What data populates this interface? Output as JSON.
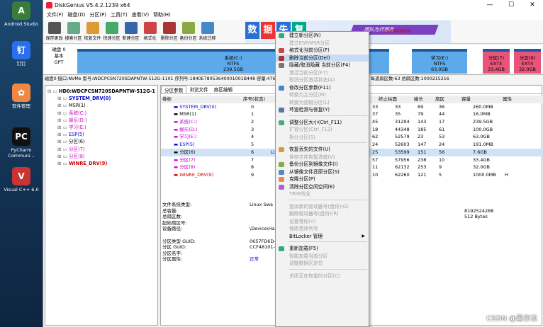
{
  "desktop": [
    {
      "label": "Android Studio",
      "glyph": "A",
      "color": "#3a7d3a"
    },
    {
      "label": "钉钉",
      "glyph": "钉",
      "color": "#2a6ff0"
    },
    {
      "label": "软件管理",
      "glyph": "✿",
      "color": "#e84"
    },
    {
      "label": "PyCharm Communi...",
      "glyph": "PC",
      "color": "#111"
    },
    {
      "label": "Visual C++ 6.0",
      "glyph": "V",
      "color": "#c33"
    }
  ],
  "window": {
    "title": "DiskGenius V5.4.2.1239 x64",
    "controls": [
      "—",
      "☐",
      "✕"
    ]
  },
  "menu": [
    "文件(F)",
    "磁盘(D)",
    "分区(P)",
    "工具(T)",
    "查看(V)",
    "帮助(H)"
  ],
  "toolbar": [
    {
      "label": "保存更改",
      "color": "#555"
    },
    {
      "label": "搜索分区",
      "color": "#6a8"
    },
    {
      "label": "恢复文件",
      "color": "#d93"
    },
    {
      "label": "快速分区",
      "color": "#4a6"
    },
    {
      "label": "新建分区",
      "color": "#36a"
    },
    {
      "label": "格式化",
      "color": "#c44"
    },
    {
      "label": "删除分区",
      "color": "#a33"
    },
    {
      "label": "备份分区",
      "color": "#8a4"
    },
    {
      "label": "系统迁移",
      "color": "#48c"
    }
  ],
  "banner": {
    "tiles": [
      "数",
      "据",
      "失",
      "复"
    ],
    "tile_colors": [
      "#2a6fd6",
      "#e33",
      "#2a6fd6",
      "#0a8"
    ],
    "slogan": "团队为您服务",
    "phone": "400-008-9958",
    "qq": "QQ"
  },
  "disk": {
    "label1": "磁盘 0",
    "label2": "基本",
    "label3": "GPT",
    "parts": [
      {
        "name": "系统(C:)",
        "fs": "NTFS",
        "size": "239.5GB",
        "color": "#5da9e9"
      },
      {
        "name": "学习(E:)",
        "fs": "NTFS",
        "size": "63.0GB",
        "color": "#5da9e9"
      },
      {
        "name": "分区(7)",
        "fs": "EXT4",
        "size": "33.4GB",
        "color": "#e8547a"
      },
      {
        "name": "分区(8)",
        "fs": "EXT4",
        "size": "32.0GB",
        "color": "#e8547a"
      }
    ]
  },
  "infoline": "磁盘0 接口:NVMe  型号:WDCPCSN720SDAPNTW-512G-1101  序列号:1840E78053640001001B448  容量:476.9GB(488386MB)  柱面数:62260  磁头数:255  每道扇区数:63  总扇区数:1000215216",
  "tree": [
    {
      "t": "HD0:WDCPCSN720SDAPNTW-512G-1",
      "c": "#000",
      "bold": true,
      "ind": 0
    },
    {
      "t": "SYSTEM_DRV(0)",
      "c": "#00c",
      "bold": true,
      "ind": 1
    },
    {
      "t": "MSR(1)",
      "c": "#000",
      "ind": 1
    },
    {
      "t": "系统(C:)",
      "c": "#c0c",
      "ind": 1
    },
    {
      "t": "娱乐(D:)",
      "c": "#c0c",
      "ind": 1
    },
    {
      "t": "学习(E:)",
      "c": "#c0c",
      "ind": 1
    },
    {
      "t": "ESP(5)",
      "c": "#00c",
      "ind": 1
    },
    {
      "t": "分区(6)",
      "c": "#000",
      "ind": 1
    },
    {
      "t": "分区(7)",
      "c": "#c0c",
      "ind": 1
    },
    {
      "t": "分区(8)",
      "c": "#c0c",
      "ind": 1
    },
    {
      "t": "WINRE_DRV(9)",
      "c": "#c00",
      "bold": true,
      "ind": 1
    }
  ],
  "tabs": [
    "分区参数",
    "浏览文件",
    "扇区编辑"
  ],
  "table": {
    "headers": [
      "卷标",
      "序号(状态)",
      "终止柱面",
      "磁头",
      "扇区",
      "容量",
      "属性"
    ],
    "rows": [
      {
        "v": "SYSTEM_DRV(0)",
        "c": "#00c",
        "n": "0",
        "a": "33",
        "b": "33",
        "h": "69",
        "s": "36",
        "cap": "260.0MB",
        "attr": ""
      },
      {
        "v": "MSR(1)",
        "c": "#000",
        "n": "1",
        "a": "37",
        "b": "35",
        "h": "79",
        "s": "44",
        "cap": "16.0MB",
        "attr": ""
      },
      {
        "v": "系统(C:)",
        "c": "#c0c",
        "n": "2",
        "a": "45",
        "b": "31294",
        "h": "143",
        "s": "17",
        "cap": "239.5GB",
        "attr": ""
      },
      {
        "v": "娱乐(D:)",
        "c": "#c0c",
        "n": "3",
        "a": "18",
        "b": "44348",
        "h": "185",
        "s": "61",
        "cap": "100.0GB",
        "attr": ""
      },
      {
        "v": "学习(E:)",
        "c": "#c0c",
        "n": "4",
        "a": "62",
        "b": "52579",
        "h": "23",
        "s": "53",
        "cap": "63.0GB",
        "attr": ""
      },
      {
        "v": "ESP(5)",
        "c": "#00c",
        "n": "5",
        "a": "24",
        "b": "52603",
        "h": "147",
        "s": "24",
        "cap": "191.0MB",
        "attr": ""
      },
      {
        "v": "分区(6)",
        "c": "#000",
        "n": "6",
        "a": "25",
        "b": "53599",
        "h": "151",
        "s": "56",
        "cap": "7.6GB",
        "attr": "",
        "sel": true,
        "extra": "Li"
      },
      {
        "v": "分区(7)",
        "c": "#c0c",
        "n": "7",
        "a": "57",
        "b": "57956",
        "h": "238",
        "s": "10",
        "cap": "33.4GB",
        "attr": ""
      },
      {
        "v": "分区(8)",
        "c": "#c0c",
        "n": "8",
        "a": "11",
        "b": "62132",
        "h": "253",
        "s": "9",
        "cap": "32.0GB",
        "attr": ""
      },
      {
        "v": "WINRE_DRV(9)",
        "c": "#c00",
        "n": "9",
        "a": "10",
        "b": "62260",
        "h": "121",
        "s": "5",
        "cap": "1000.0MB",
        "attr": "H"
      }
    ]
  },
  "details": [
    {
      "k": "文件系统类型:",
      "v": "Linux Swa"
    },
    {
      "k": "总容量:",
      "v": ""
    },
    {
      "k": "总扇区数:",
      "v": ""
    },
    {
      "k": "起始扇区号:",
      "v": ""
    },
    {
      "k": "设备路径:",
      "v": "\\Device\\Ha"
    },
    {
      "k": "",
      "v": ""
    },
    {
      "k": "分区类型 GUID:",
      "v": "0657FD6D-"
    },
    {
      "k": "分区 GUID:",
      "v": "CCF48101-"
    },
    {
      "k": "分区名字:",
      "v": ""
    },
    {
      "k": "分区属性:",
      "v": "正常"
    }
  ],
  "details_right": [
    "8192524288",
    "512 Bytes"
  ],
  "context_menu": [
    {
      "l": "建立新分区(N)",
      "c": "#3a7"
    },
    {
      "l": "建立ESP/MSR分区",
      "d": true
    },
    {
      "l": "格式化当前分区(F)",
      "c": "#c44"
    },
    {
      "l": "删除当前分区(Del)",
      "c": "#a33",
      "hl": true
    },
    {
      "l": "隐藏/取消隐藏 当前分区(F4)",
      "c": "#777"
    },
    {
      "l": "激活当前分区(F7)",
      "d": true
    },
    {
      "l": "取消分区激活状态(A)",
      "d": true
    },
    {
      "l": "修改分区参数(F11)",
      "c": "#48c"
    },
    {
      "l": "转换为主分区(M)",
      "d": true
    },
    {
      "l": "转换为逻辑分区(L)",
      "d": true
    },
    {
      "l": "坏道检测与修复(Y)",
      "c": "#57a"
    },
    {
      "sep": true
    },
    {
      "l": "调整分区大小(Ctrl_F11)",
      "c": "#4a8"
    },
    {
      "l": "扩容分区(Ctrl_F12)",
      "d": true
    },
    {
      "l": "拆分分区(S)",
      "d": true
    },
    {
      "sep": true
    },
    {
      "l": "恢复丢失的文件(U)",
      "c": "#d93"
    },
    {
      "l": "保存文件恢复进度(V)",
      "d": true
    },
    {
      "l": "备份分区到镜像文件(I)",
      "c": "#8a4"
    },
    {
      "l": "从镜像文件还原分区(S)",
      "c": "#58b"
    },
    {
      "l": "克隆分区(P)",
      "c": "#e84"
    },
    {
      "l": "清除分区空闲空间(E)",
      "c": "#a6c"
    },
    {
      "l": "TRIM优化",
      "d": true
    },
    {
      "sep": true
    },
    {
      "l": "指派新的驱动器号(盘符)(G)",
      "d": true
    },
    {
      "l": "删除驱动器号(盘符)(R)",
      "d": true
    },
    {
      "l": "设置卷标(V)",
      "d": true
    },
    {
      "l": "修改卷序列号",
      "d": true
    },
    {
      "l": "BitLocker 管理",
      "arrow": true
    },
    {
      "sep": true
    },
    {
      "l": "重新加载(F5)",
      "c": "#3a7"
    },
    {
      "l": "智能加载当前分区",
      "d": true
    },
    {
      "l": "调整数据区定位",
      "d": true
    },
    {
      "sep": true
    },
    {
      "l": "关闭正在恢复的分区(C)",
      "d": true
    }
  ],
  "watermark": "CSDN @墨亦淡"
}
